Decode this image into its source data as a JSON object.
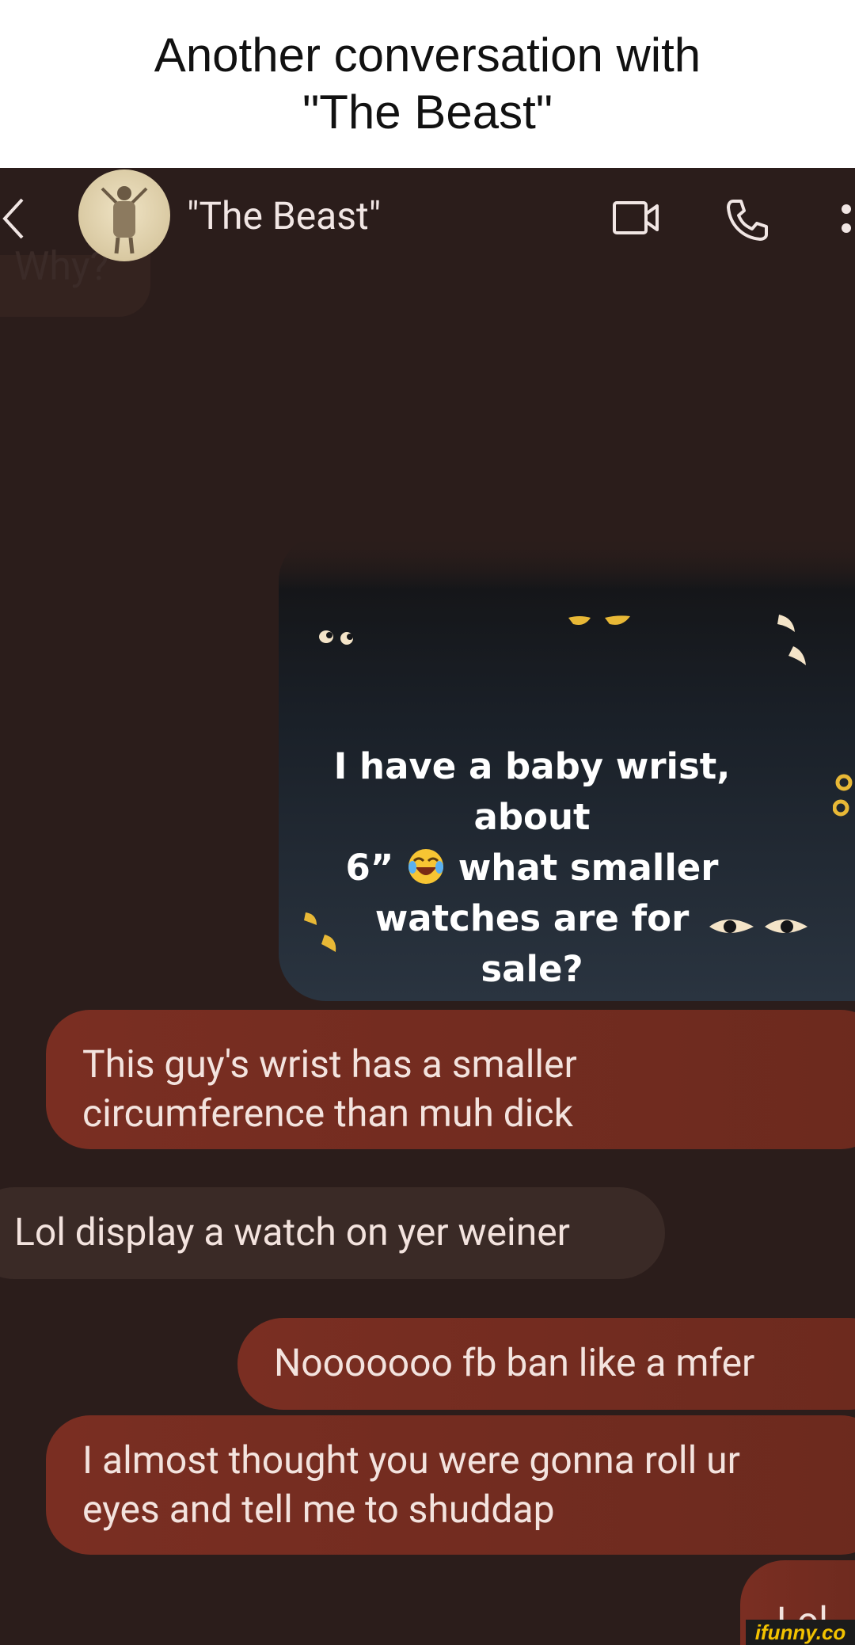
{
  "caption": {
    "line1": "Another conversation with",
    "line2": "\"The Beast\""
  },
  "header": {
    "contact_name": "\"The Beast\"",
    "icons": [
      "back-icon",
      "avatar",
      "video-call-icon",
      "phone-icon",
      "more-options-icon"
    ]
  },
  "ghost_message": "Why?",
  "image_message": {
    "line1": "I have a baby wrist, about",
    "line2_pre": "6”",
    "line2_post": "what smaller",
    "line3": "watches are for sale?",
    "emoji": "face-with-tears-of-joy"
  },
  "messages": [
    {
      "sender": "me",
      "line1": "This guy's wrist has a smaller",
      "line2": "circumference than muh dick"
    },
    {
      "sender": "them",
      "text": "Lol display a watch on yer weiner"
    },
    {
      "sender": "me",
      "text": "Nooooooo fb ban like a mfer"
    },
    {
      "sender": "me",
      "line1": "I almost thought you were gonna roll ur",
      "line2": "eyes and tell me to shuddap"
    },
    {
      "sender": "me",
      "text": "Lol"
    }
  ],
  "watermark": "ifunny.co",
  "colors": {
    "background": "#2b1d1b",
    "outgoing_bubble": "#7a2e22",
    "incoming_bubble": "#3a2a26",
    "text": "#f3e3de"
  }
}
